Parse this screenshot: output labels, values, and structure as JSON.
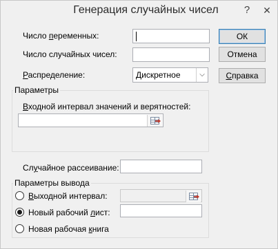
{
  "window": {
    "title": "Генерация случайных чисел",
    "help_label": "?",
    "close_label": "✕"
  },
  "fields": {
    "num_variables": {
      "label_pre": "Число ",
      "label_ul": "п",
      "label_post": "еременных:",
      "value": ""
    },
    "num_random": {
      "label_pre": "Число случайных чисел:",
      "value": ""
    },
    "distribution": {
      "label_pre": "",
      "label_ul": "Р",
      "label_post": "аспределение:",
      "value": "Дискретное"
    }
  },
  "buttons": {
    "ok": "ОК",
    "cancel": "Отмена",
    "help_pre": "",
    "help_ul": "С",
    "help_post": "правка"
  },
  "parameters": {
    "group_title": "Параметры",
    "range_label_pre": "",
    "range_label_ul": "В",
    "range_label_post": "ходной интервал значений и верятностей:",
    "range_value": ""
  },
  "seed": {
    "label_pre": "Сл",
    "label_ul": "у",
    "label_post": "чайное рассеивание:",
    "value": ""
  },
  "output": {
    "group_title": "Параметры вывода",
    "options": [
      {
        "label_pre": "",
        "label_ul": "В",
        "label_post": "ыходной интервал:",
        "checked": false
      },
      {
        "label_pre": "Новый рабочий ",
        "label_ul": "л",
        "label_post": "ист:",
        "checked": true
      },
      {
        "label_pre": "Новая рабочая ",
        "label_ul": "к",
        "label_post": "нига",
        "checked": false
      }
    ]
  },
  "icons": {
    "range_picker": "range-select-icon",
    "dropdown": "chevron-down-icon"
  }
}
